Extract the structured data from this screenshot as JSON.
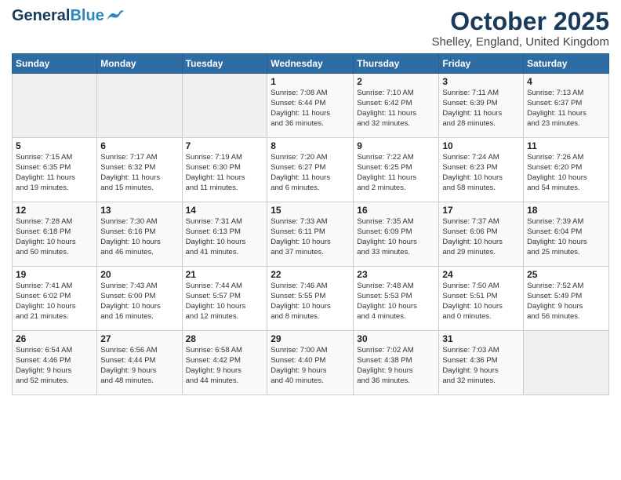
{
  "header": {
    "logo_line1": "General",
    "logo_line2": "Blue",
    "month_year": "October 2025",
    "location": "Shelley, England, United Kingdom"
  },
  "weekdays": [
    "Sunday",
    "Monday",
    "Tuesday",
    "Wednesday",
    "Thursday",
    "Friday",
    "Saturday"
  ],
  "weeks": [
    [
      {
        "day": "",
        "info": ""
      },
      {
        "day": "",
        "info": ""
      },
      {
        "day": "",
        "info": ""
      },
      {
        "day": "1",
        "info": "Sunrise: 7:08 AM\nSunset: 6:44 PM\nDaylight: 11 hours\nand 36 minutes."
      },
      {
        "day": "2",
        "info": "Sunrise: 7:10 AM\nSunset: 6:42 PM\nDaylight: 11 hours\nand 32 minutes."
      },
      {
        "day": "3",
        "info": "Sunrise: 7:11 AM\nSunset: 6:39 PM\nDaylight: 11 hours\nand 28 minutes."
      },
      {
        "day": "4",
        "info": "Sunrise: 7:13 AM\nSunset: 6:37 PM\nDaylight: 11 hours\nand 23 minutes."
      }
    ],
    [
      {
        "day": "5",
        "info": "Sunrise: 7:15 AM\nSunset: 6:35 PM\nDaylight: 11 hours\nand 19 minutes."
      },
      {
        "day": "6",
        "info": "Sunrise: 7:17 AM\nSunset: 6:32 PM\nDaylight: 11 hours\nand 15 minutes."
      },
      {
        "day": "7",
        "info": "Sunrise: 7:19 AM\nSunset: 6:30 PM\nDaylight: 11 hours\nand 11 minutes."
      },
      {
        "day": "8",
        "info": "Sunrise: 7:20 AM\nSunset: 6:27 PM\nDaylight: 11 hours\nand 6 minutes."
      },
      {
        "day": "9",
        "info": "Sunrise: 7:22 AM\nSunset: 6:25 PM\nDaylight: 11 hours\nand 2 minutes."
      },
      {
        "day": "10",
        "info": "Sunrise: 7:24 AM\nSunset: 6:23 PM\nDaylight: 10 hours\nand 58 minutes."
      },
      {
        "day": "11",
        "info": "Sunrise: 7:26 AM\nSunset: 6:20 PM\nDaylight: 10 hours\nand 54 minutes."
      }
    ],
    [
      {
        "day": "12",
        "info": "Sunrise: 7:28 AM\nSunset: 6:18 PM\nDaylight: 10 hours\nand 50 minutes."
      },
      {
        "day": "13",
        "info": "Sunrise: 7:30 AM\nSunset: 6:16 PM\nDaylight: 10 hours\nand 46 minutes."
      },
      {
        "day": "14",
        "info": "Sunrise: 7:31 AM\nSunset: 6:13 PM\nDaylight: 10 hours\nand 41 minutes."
      },
      {
        "day": "15",
        "info": "Sunrise: 7:33 AM\nSunset: 6:11 PM\nDaylight: 10 hours\nand 37 minutes."
      },
      {
        "day": "16",
        "info": "Sunrise: 7:35 AM\nSunset: 6:09 PM\nDaylight: 10 hours\nand 33 minutes."
      },
      {
        "day": "17",
        "info": "Sunrise: 7:37 AM\nSunset: 6:06 PM\nDaylight: 10 hours\nand 29 minutes."
      },
      {
        "day": "18",
        "info": "Sunrise: 7:39 AM\nSunset: 6:04 PM\nDaylight: 10 hours\nand 25 minutes."
      }
    ],
    [
      {
        "day": "19",
        "info": "Sunrise: 7:41 AM\nSunset: 6:02 PM\nDaylight: 10 hours\nand 21 minutes."
      },
      {
        "day": "20",
        "info": "Sunrise: 7:43 AM\nSunset: 6:00 PM\nDaylight: 10 hours\nand 16 minutes."
      },
      {
        "day": "21",
        "info": "Sunrise: 7:44 AM\nSunset: 5:57 PM\nDaylight: 10 hours\nand 12 minutes."
      },
      {
        "day": "22",
        "info": "Sunrise: 7:46 AM\nSunset: 5:55 PM\nDaylight: 10 hours\nand 8 minutes."
      },
      {
        "day": "23",
        "info": "Sunrise: 7:48 AM\nSunset: 5:53 PM\nDaylight: 10 hours\nand 4 minutes."
      },
      {
        "day": "24",
        "info": "Sunrise: 7:50 AM\nSunset: 5:51 PM\nDaylight: 10 hours\nand 0 minutes."
      },
      {
        "day": "25",
        "info": "Sunrise: 7:52 AM\nSunset: 5:49 PM\nDaylight: 9 hours\nand 56 minutes."
      }
    ],
    [
      {
        "day": "26",
        "info": "Sunrise: 6:54 AM\nSunset: 4:46 PM\nDaylight: 9 hours\nand 52 minutes."
      },
      {
        "day": "27",
        "info": "Sunrise: 6:56 AM\nSunset: 4:44 PM\nDaylight: 9 hours\nand 48 minutes."
      },
      {
        "day": "28",
        "info": "Sunrise: 6:58 AM\nSunset: 4:42 PM\nDaylight: 9 hours\nand 44 minutes."
      },
      {
        "day": "29",
        "info": "Sunrise: 7:00 AM\nSunset: 4:40 PM\nDaylight: 9 hours\nand 40 minutes."
      },
      {
        "day": "30",
        "info": "Sunrise: 7:02 AM\nSunset: 4:38 PM\nDaylight: 9 hours\nand 36 minutes."
      },
      {
        "day": "31",
        "info": "Sunrise: 7:03 AM\nSunset: 4:36 PM\nDaylight: 9 hours\nand 32 minutes."
      },
      {
        "day": "",
        "info": ""
      }
    ]
  ]
}
